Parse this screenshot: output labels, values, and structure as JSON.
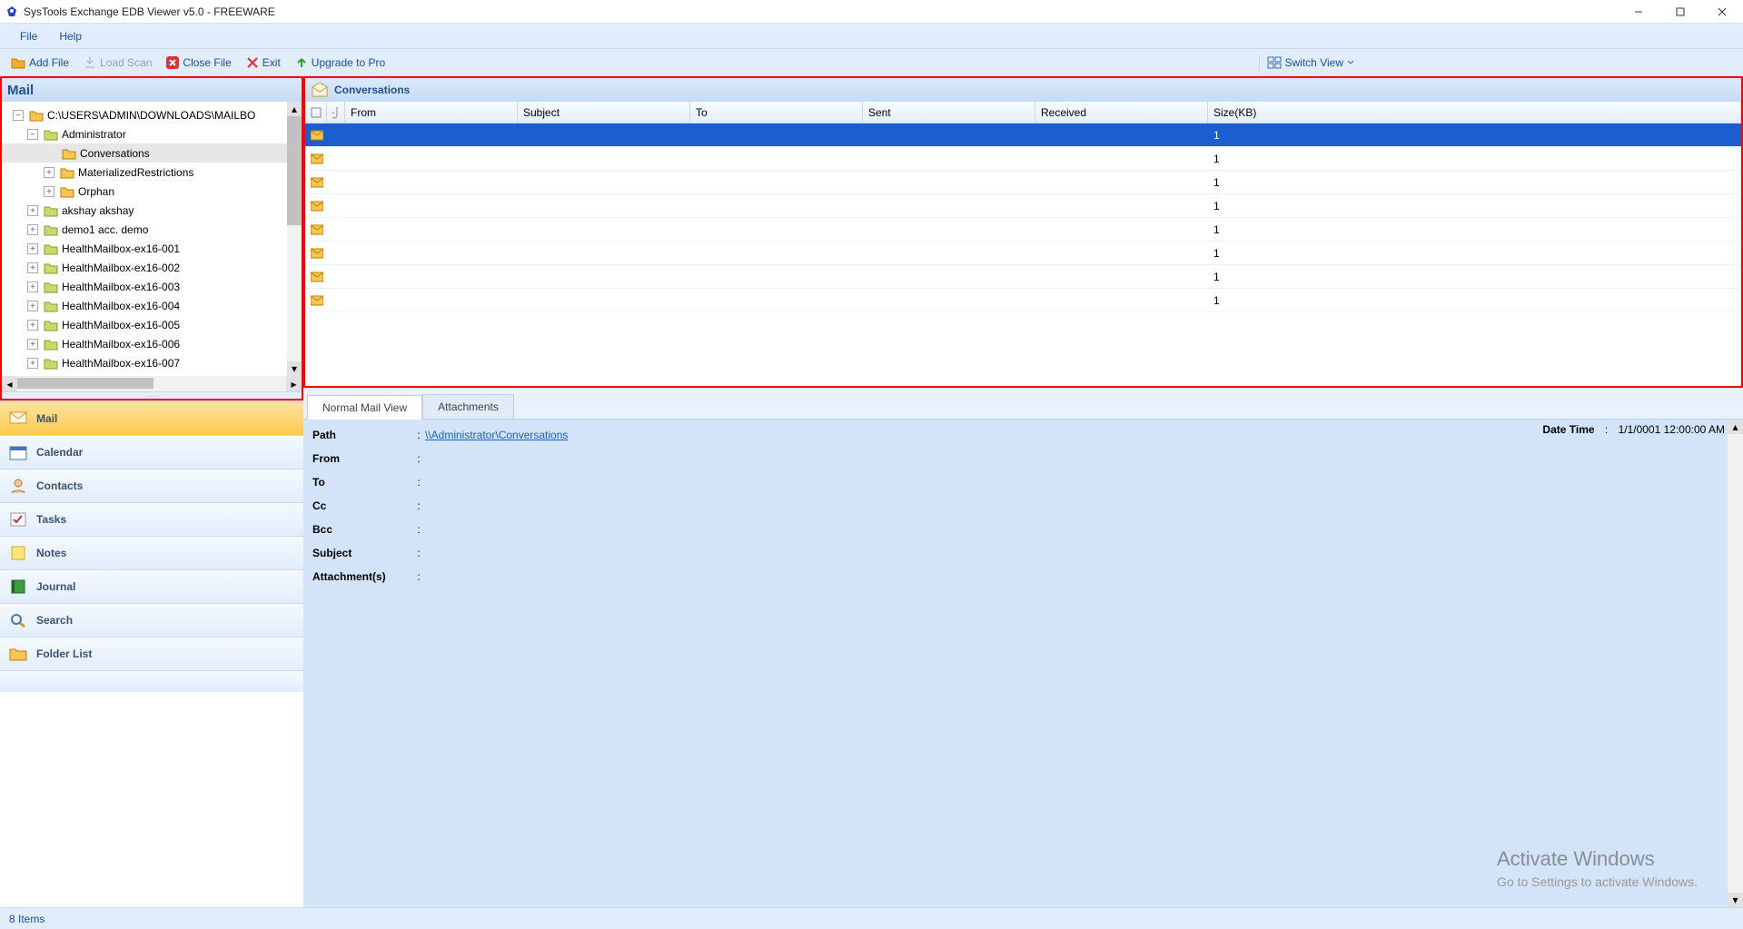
{
  "title": "SysTools Exchange EDB Viewer v5.0 - FREEWARE",
  "menu": {
    "file": "File",
    "help": "Help"
  },
  "toolbar": {
    "add_file": "Add File",
    "load_scan": "Load Scan",
    "close_file": "Close File",
    "exit": "Exit",
    "upgrade": "Upgrade to Pro",
    "switch_view": "Switch View"
  },
  "left": {
    "header": "Mail",
    "tree": {
      "root": "C:\\USERS\\ADMIN\\DOWNLOADS\\MAILBO",
      "admin": "Administrator",
      "conversations": "Conversations",
      "mat": "MaterializedRestrictions",
      "orphan": "Orphan",
      "items": [
        "akshay akshay",
        "demo1 acc. demo",
        "HealthMailbox-ex16-001",
        "HealthMailbox-ex16-002",
        "HealthMailbox-ex16-003",
        "HealthMailbox-ex16-004",
        "HealthMailbox-ex16-005",
        "HealthMailbox-ex16-006",
        "HealthMailbox-ex16-007"
      ]
    },
    "nav": {
      "mail": "Mail",
      "calendar": "Calendar",
      "contacts": "Contacts",
      "tasks": "Tasks",
      "notes": "Notes",
      "journal": "Journal",
      "search": "Search",
      "folder_list": "Folder List"
    }
  },
  "conv": {
    "header": "Conversations",
    "cols": {
      "from": "From",
      "subject": "Subject",
      "to": "To",
      "sent": "Sent",
      "received": "Received",
      "size": "Size(KB)"
    },
    "rows": [
      {
        "from": "",
        "subject": "",
        "to": "",
        "sent": "",
        "received": "",
        "size": "1",
        "selected": true
      },
      {
        "from": "",
        "subject": "",
        "to": "",
        "sent": "",
        "received": "",
        "size": "1"
      },
      {
        "from": "",
        "subject": "",
        "to": "",
        "sent": "",
        "received": "",
        "size": "1"
      },
      {
        "from": "",
        "subject": "",
        "to": "",
        "sent": "",
        "received": "",
        "size": "1"
      },
      {
        "from": "",
        "subject": "",
        "to": "",
        "sent": "",
        "received": "",
        "size": "1"
      },
      {
        "from": "",
        "subject": "",
        "to": "",
        "sent": "",
        "received": "",
        "size": "1"
      },
      {
        "from": "",
        "subject": "",
        "to": "",
        "sent": "",
        "received": "",
        "size": "1"
      },
      {
        "from": "",
        "subject": "",
        "to": "",
        "sent": "",
        "received": "",
        "size": "1"
      }
    ]
  },
  "preview": {
    "tab_normal": "Normal Mail View",
    "tab_attachments": "Attachments",
    "path_label": "Path",
    "path_value": "\\\\Administrator\\Conversations",
    "datetime_label": "Date Time",
    "datetime_value": "1/1/0001 12:00:00 AM",
    "from_label": "From",
    "to_label": "To",
    "cc_label": "Cc",
    "bcc_label": "Bcc",
    "subject_label": "Subject",
    "attach_label": "Attachment(s)"
  },
  "watermark": {
    "line1": "Activate Windows",
    "line2": "Go to Settings to activate Windows."
  },
  "status": "8 Items"
}
